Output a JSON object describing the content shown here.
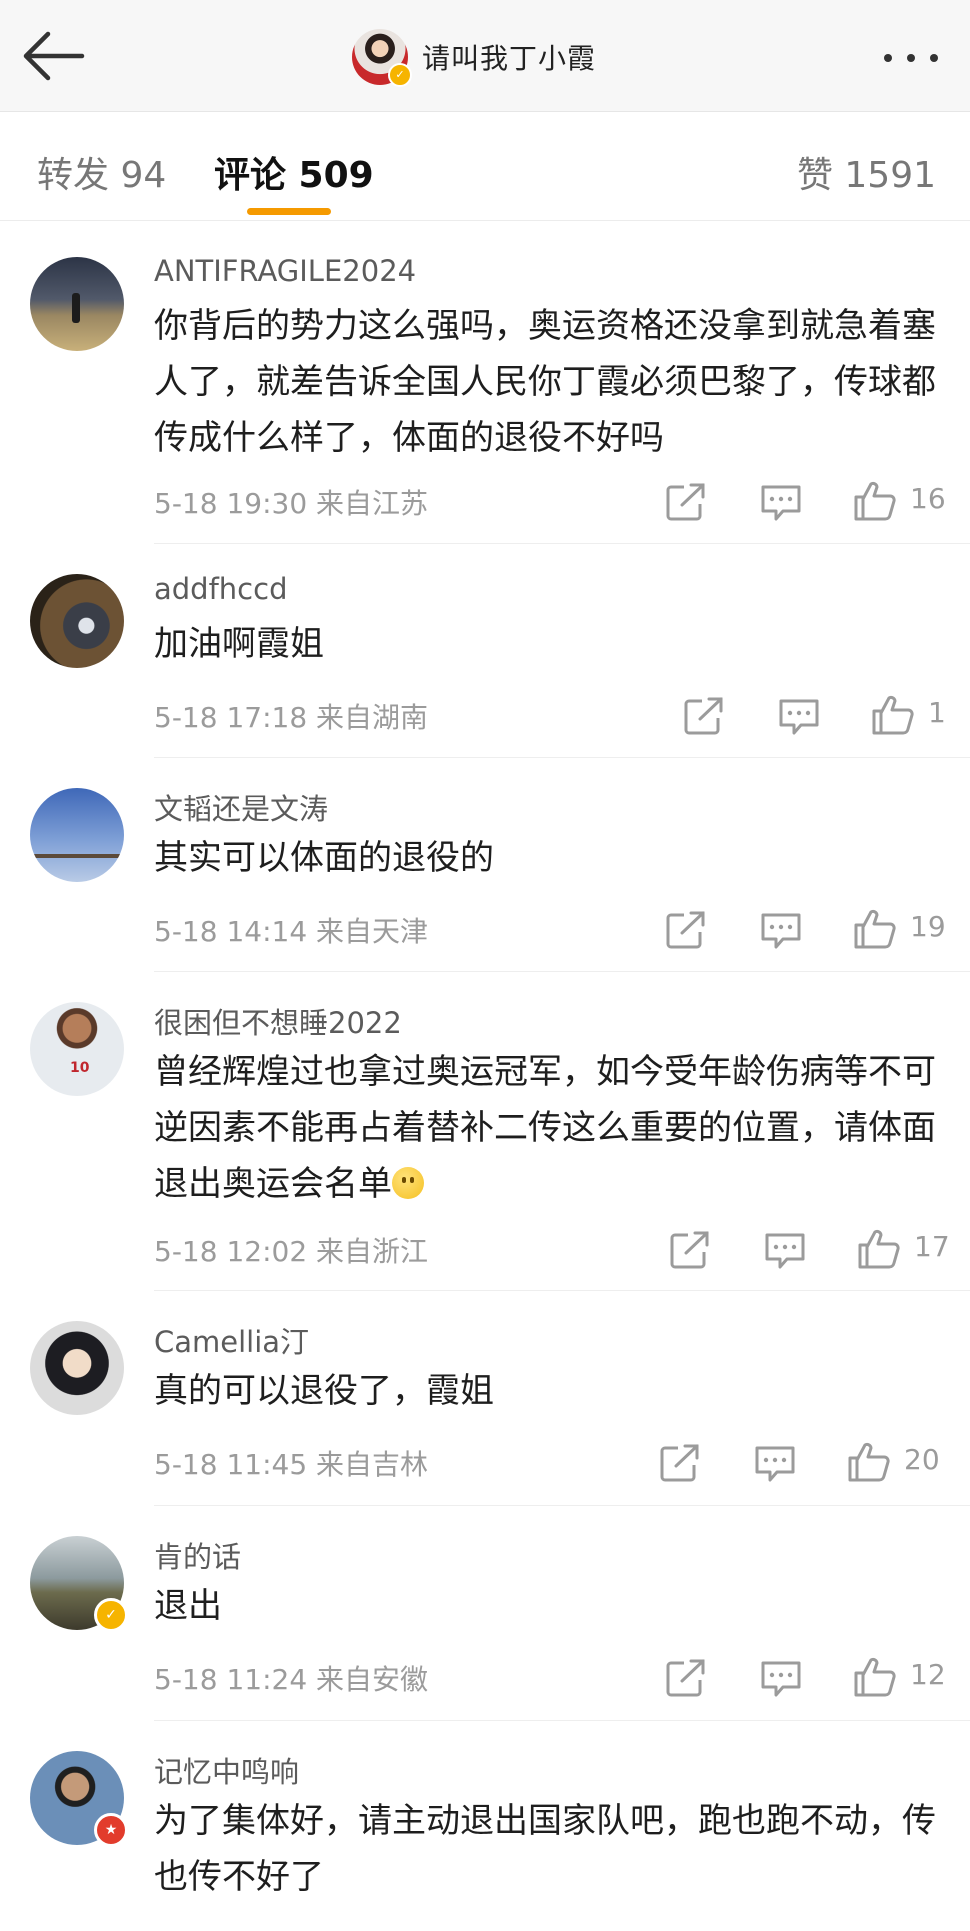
{
  "header": {
    "title": "请叫我丁小霞",
    "back_icon": "back-arrow-icon",
    "more_icon": "more-dots-icon"
  },
  "tabs": [
    {
      "label": "转发 94"
    },
    {
      "label": "评论 509"
    },
    {
      "label": "赞 1591"
    }
  ],
  "colors": {
    "accent": "#f59a00",
    "meta_text": "#9b9b9b",
    "author_text": "#5b5b5b",
    "vip_badge": "#f6b400",
    "red_badge": "#e23c2c"
  },
  "comments": [
    {
      "author": "ANTIFRAGILE2024",
      "text": "你背后的势力这么强吗，奥运资格还没拿到就急着塞人了，就差告诉全国人民你丁霞必须巴黎了，传球都传成什么样了，体面的退役不好吗",
      "time": "5-18 19:30",
      "location": "来自江苏",
      "likes": "16"
    },
    {
      "author": "addfhccd",
      "text": "加油啊霞姐",
      "time": "5-18 17:18",
      "location": "来自湖南",
      "likes": "1"
    },
    {
      "author": "文韬还是文涛",
      "text": "其实可以体面的退役的",
      "time": "5-18 14:14",
      "location": "来自天津",
      "likes": "19"
    },
    {
      "author": "很困但不想睡2022",
      "text": "曾经辉煌过也拿过奥运冠军，如今受年龄伤病等不可逆因素不能再占着替补二传这么重要的位置，请体面退出奥运会名单",
      "time": "5-18 12:02",
      "location": "来自浙江",
      "likes": "17"
    },
    {
      "author": "Camellia汀",
      "text": "真的可以退役了，霞姐",
      "time": "5-18 11:45",
      "location": "来自吉林",
      "likes": "20"
    },
    {
      "author": "肯的话",
      "text": "退出",
      "time": "5-18 11:24",
      "location": "来自安徽",
      "likes": "12"
    },
    {
      "author": "记忆中鸣响",
      "text": "为了集体好，请主动退出国家队吧，跑也跑不动，传也传不好了"
    }
  ]
}
